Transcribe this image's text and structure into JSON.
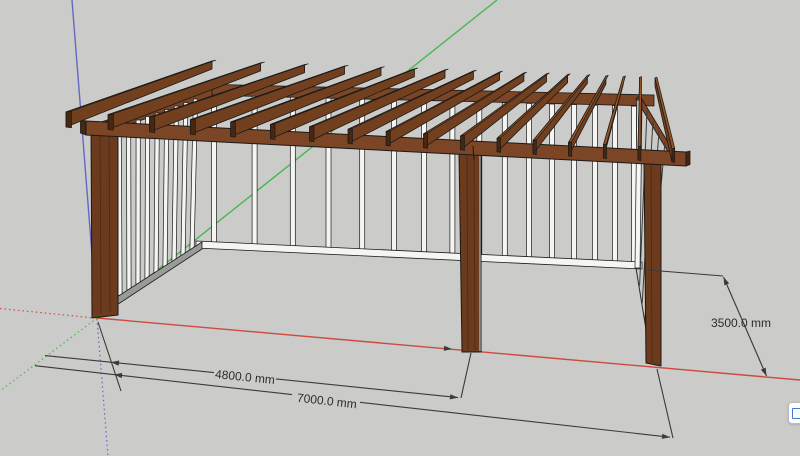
{
  "viewport": {
    "background_color": "#cbcbc9",
    "outline_color": "#1a1a1a"
  },
  "axes": {
    "red_color": "#cd4a40",
    "green_color": "#44b94c",
    "blue_color": "#6567c8"
  },
  "model": {
    "rafter_count": 17,
    "back_stud_count": 16,
    "left_stud_count": 10,
    "right_stud_count": 4,
    "colors": {
      "wood_side": "#72401f",
      "wood_top": "#945427",
      "wood_end": "#46270f",
      "beam": "#7b4526",
      "post": "#6c3a1d",
      "post_grain": "#4f2b12",
      "stud_face": "#f5f5f3",
      "stud_shade": "#9a9a98"
    }
  },
  "dimensions": {
    "line_color": "#3a3a3a",
    "text_color": "#2d2d2d",
    "items": [
      {
        "id": "dim-4800",
        "label": "4800.0 mm"
      },
      {
        "id": "dim-7000",
        "label": "7000.0 mm"
      },
      {
        "id": "dim-3500",
        "label": "3500.0 mm"
      }
    ]
  }
}
